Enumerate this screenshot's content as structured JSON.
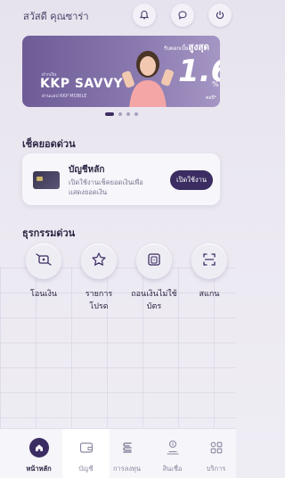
{
  "header": {
    "greeting": "สวัสดี คุณซาร่า",
    "icons": [
      "bell-icon",
      "chat-icon",
      "power-icon"
    ]
  },
  "banner": {
    "top_text_small": "รับดอกเบี้ย",
    "top_text_big": "สูงสุด",
    "promo_small": "ฝากเงิน",
    "brand": "KKP SAVVY",
    "brand_sub": "ผ่านแอป KKP MOBILE",
    "rate": "1.6",
    "percent": "%",
    "per_year": "ต่อปี*",
    "carousel_total": 4,
    "carousel_active": 1
  },
  "balance_section": {
    "title": "เช็คยอดด่วน",
    "card_title": "บัญชีหลัก",
    "card_desc": "เปิดใช้งานเช็คยอดเงินเพื่อแสดงยอดเงิน",
    "enable_label": "เปิดใช้งาน"
  },
  "quick_section": {
    "title": "ธุรกรรมด่วน",
    "actions": [
      {
        "label": "โอนเงิน",
        "icon": "transfer-icon"
      },
      {
        "label": "รายการโปรด",
        "icon": "star-icon"
      },
      {
        "label": "ถอนเงินไม่ใช้บัตร",
        "icon": "cardless-withdraw-icon"
      },
      {
        "label": "สแกน",
        "icon": "scan-icon"
      }
    ]
  },
  "tabbar": {
    "tabs": [
      {
        "label": "หน้าหลัก",
        "icon": "home-icon"
      },
      {
        "label": "บัญชี",
        "icon": "wallet-icon"
      },
      {
        "label": "การลงทุน",
        "icon": "invest-icon"
      },
      {
        "label": "สินเชื่อ",
        "icon": "loan-icon"
      },
      {
        "label": "บริการ",
        "icon": "services-icon"
      }
    ],
    "active": "หน้าหลัก"
  },
  "colors": {
    "primary": "#3b2d62",
    "background": "#ebe8f1",
    "banner": "#7a68a3"
  }
}
